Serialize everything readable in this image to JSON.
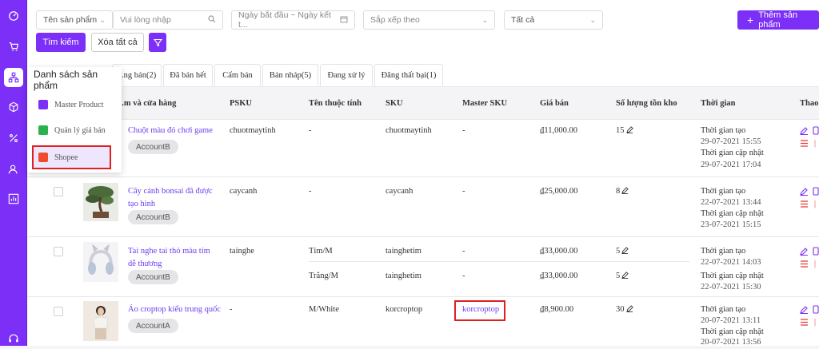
{
  "filters": {
    "field_select": "Tên sản phẩm",
    "search_placeholder": "Vui lòng nhập",
    "date_range": "Ngày bắt đầu ~ Ngày kết t...",
    "sort_placeholder": "Sắp xếp theo",
    "status_select": "Tất cả",
    "add_product": "Thêm sản phẩm",
    "search_button": "Tìm kiếm",
    "clear_button": "Xóa tất cả"
  },
  "tabs": [
    "...ng bán(2)",
    "Đã bán hết",
    "Cấm bán",
    "Bản nháp(5)",
    "Đang xử lý",
    "Đăng thất bại(1)"
  ],
  "menu": {
    "title": "Danh sách sản phẩm",
    "items": [
      {
        "label": "Master Product",
        "icon": "master-product-icon",
        "color": "#7b2ff7"
      },
      {
        "label": "Quản lý giá bán",
        "icon": "price-manage-icon",
        "color": "#2bb24c"
      },
      {
        "label": "Shopee",
        "icon": "shopee-icon",
        "color": "#ee4d2d"
      }
    ]
  },
  "columns": {
    "name": "...m và cửa hàng",
    "psku": "PSKU",
    "attr": "Tên thuộc tính",
    "sku": "SKU",
    "master_sku": "Master SKU",
    "price": "Giá bán",
    "stock": "Số lượng tồn kho",
    "time": "Thời gian",
    "ops": "Thao"
  },
  "labels": {
    "created": "Thời gian tạo",
    "updated": "Thời gian cập nhật"
  },
  "rows": [
    {
      "name": "Chuột màu đỏ chơi game",
      "store": "AccountB",
      "psku": "chuotmaytinh",
      "attr": "-",
      "sku": "chuotmaytinh",
      "master_sku": "-",
      "price": "₫11,000.00",
      "stock": "15",
      "created": "29-07-2021 15:55",
      "updated": "29-07-2021 17:04"
    },
    {
      "name": "Cây cảnh bonsai đã được tạo hình",
      "store": "AccountB",
      "psku": "caycanh",
      "attr": "-",
      "sku": "caycanh",
      "master_sku": "-",
      "price": "₫25,000.00",
      "stock": "8",
      "created": "22-07-2021 13:44",
      "updated": "23-07-2021 15:15"
    },
    {
      "name": "Tai nghe tai thỏ màu tím dễ thương",
      "store": "AccountB",
      "psku": "tainghe",
      "variants": [
        {
          "attr": "Tím/M",
          "sku": "tainghetim",
          "master_sku": "-",
          "price": "₫33,000.00",
          "stock": "5",
          "created": "22-07-2021 14:03"
        },
        {
          "attr": "Trắng/M",
          "sku": "tainghetim",
          "master_sku": "-",
          "price": "₫33,000.00",
          "stock": "5",
          "updated": "22-07-2021 15:30"
        }
      ]
    },
    {
      "name": "Áo croptop kiểu trung quốc",
      "store": "AccountA",
      "psku": "-",
      "attr": "M/White",
      "sku": "korcroptop",
      "master_sku": "korcroptop",
      "price": "₫8,900.00",
      "stock": "30",
      "created": "20-07-2021 13:11",
      "updated": "20-07-2021 13:56"
    }
  ],
  "colors": {
    "accent": "#7b2ff7",
    "link": "#6b3df0",
    "danger": "#e53935",
    "highlight_box": "#e02020"
  }
}
